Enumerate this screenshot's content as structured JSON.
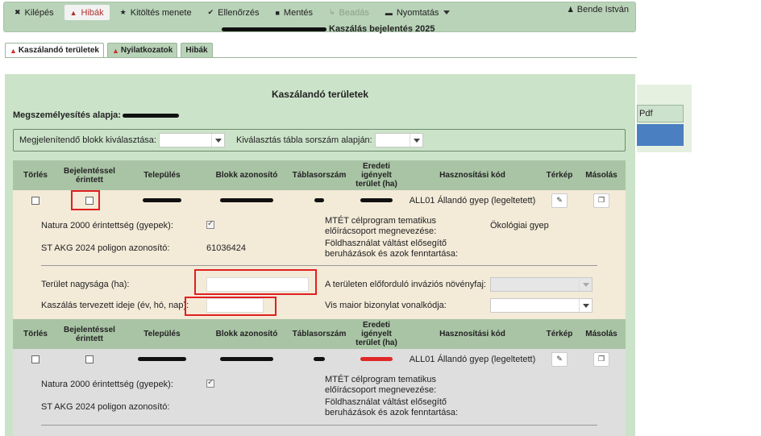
{
  "toolbar": {
    "items": [
      {
        "label": "Kilépés",
        "icon": "close-icon"
      },
      {
        "label": "Hibák",
        "icon": "warning-icon"
      },
      {
        "label": "Kitöltés menete",
        "icon": "star-icon"
      },
      {
        "label": "Ellenőrzés",
        "icon": "check-icon"
      },
      {
        "label": "Mentés",
        "icon": "save-icon"
      },
      {
        "label": "Beadás",
        "icon": "submit-icon"
      },
      {
        "label": "Nyomtatás",
        "icon": "print-icon"
      }
    ],
    "user": "Bende István",
    "subtitle_text": "Kaszálás bejelentés 2025"
  },
  "tabs": [
    "Kaszálandó területek",
    "Nyilatkozatok",
    "Hibák"
  ],
  "right_panel": {
    "pdf_label": "Pdf"
  },
  "panel": {
    "title": "Kaszálandó területek",
    "ident_label": "Megszemélyesítés alapja:",
    "filter": {
      "block_label": "Megjelenítendő blokk kiválasztása:",
      "table_label": "Kiválasztás tábla sorszám alapján:"
    }
  },
  "table": {
    "headers": {
      "torles": "Törlés",
      "bejelentessel": "Bejelentéssel érintett",
      "telepules": "Település",
      "blokk": "Blokk azonosító",
      "tablasorszam": "Táblasorszám",
      "eredeti": "Eredeti igényelt terület (ha)",
      "hasznositasi": "Hasznosítási kód",
      "terkep": "Térkép",
      "masolas": "Másolás"
    },
    "rows": [
      {
        "hasznositasi_kod": "ALL01 Állandó gyep (legeltetett)",
        "natura_label": "Natura 2000 érintettség (gyepek):",
        "st_akg_label": "ST AKG 2024 poligon azonosító:",
        "st_akg_value": "61036424",
        "mtet_label": "MTÉT célprogram tematikus előírácsoport megnevezése:",
        "mtet_value": "Ökológiai gyep",
        "foldhasznalat_label": "Földhasználat váltást elősegítő beruházások és azok fenntartása:",
        "terulet_label": "Terület nagysága (ha):",
        "kaszalas_label": "Kaszálás tervezett ideje (év, hó, nap):",
        "invaziv_label": "A területen előforduló inváziós növényfaj:",
        "vis_maior_label": "Vis maior bizonylat vonalkódja:"
      },
      {
        "hasznositasi_kod": "ALL01 Állandó gyep (legeltetett)",
        "natura_label": "Natura 2000 érintettség (gyepek):",
        "st_akg_label": "ST AKG 2024 poligon azonosító:",
        "mtet_label": "MTÉT célprogram tematikus előírácsoport megnevezése:",
        "foldhasznalat_label": "Földhasználat váltást elősegítő beruházások és azok fenntartása:"
      }
    ]
  }
}
